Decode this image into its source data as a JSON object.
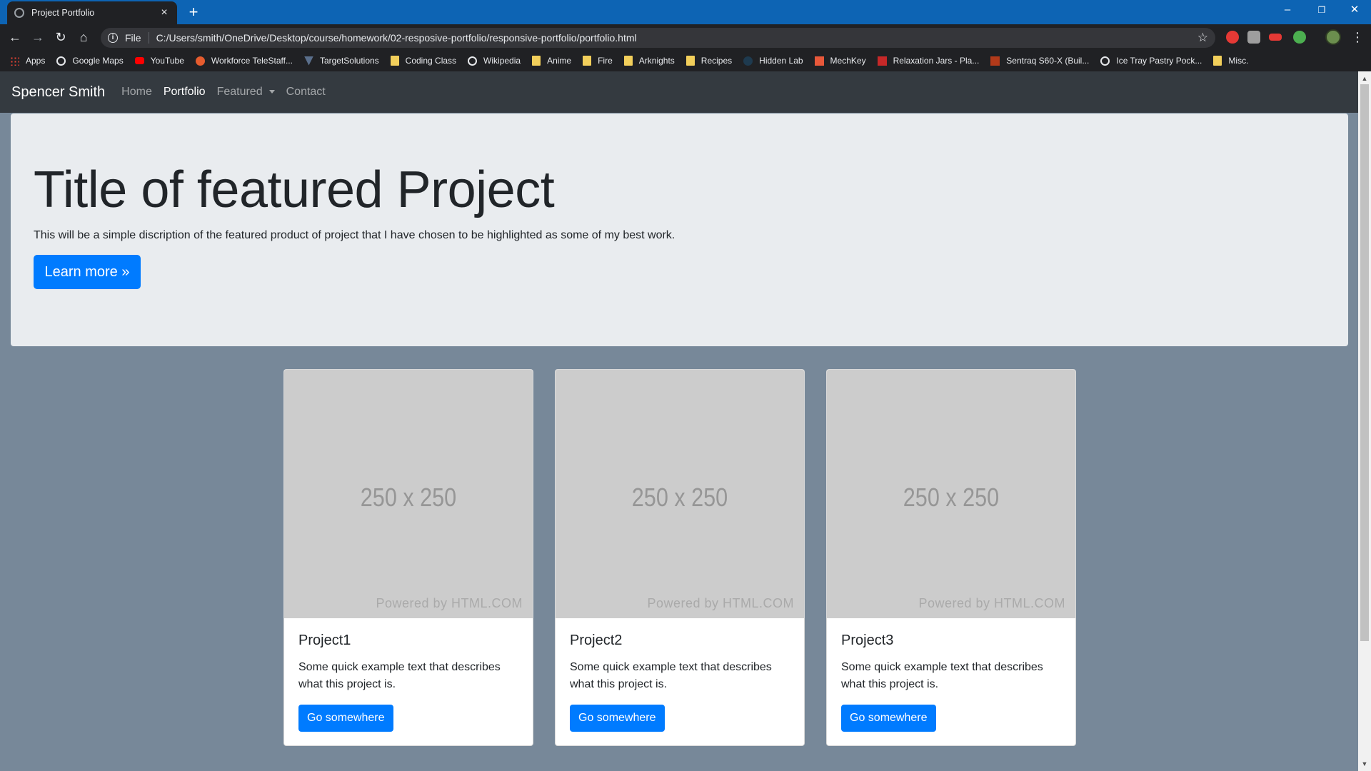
{
  "browser": {
    "tab_title": "Project Portfolio",
    "tab_close": "×",
    "new_tab": "+",
    "window_controls": [
      "–",
      "❐",
      "✕"
    ],
    "address_scheme": "File",
    "address_url": "C:/Users/smith/OneDrive/Desktop/course/homework/02-resposive-portfolio/responsive-portfolio/portfolio.html",
    "bookmarks": [
      {
        "label": "Apps",
        "icon": "apps-grid-icon"
      },
      {
        "label": "Google Maps",
        "icon": "globe-icon"
      },
      {
        "label": "YouTube",
        "icon": "youtube-icon"
      },
      {
        "label": "Workforce TeleStaff...",
        "icon": "telestaff-icon"
      },
      {
        "label": "TargetSolutions",
        "icon": "targetsolutions-icon"
      },
      {
        "label": "Coding Class",
        "icon": "folder-icon"
      },
      {
        "label": "Wikipedia",
        "icon": "globe-icon"
      },
      {
        "label": "Anime",
        "icon": "folder-icon"
      },
      {
        "label": "Fire",
        "icon": "folder-icon"
      },
      {
        "label": "Arknights",
        "icon": "folder-icon"
      },
      {
        "label": "Recipes",
        "icon": "folder-icon"
      },
      {
        "label": "Hidden Lab",
        "icon": "hiddenlab-icon"
      },
      {
        "label": "MechKey",
        "icon": "mechkey-icon"
      },
      {
        "label": "Relaxation Jars - Pla...",
        "icon": "relaxation-icon"
      },
      {
        "label": "Sentraq S60-X (Buil...",
        "icon": "sentraq-icon"
      },
      {
        "label": "Ice Tray Pastry Pock...",
        "icon": "globe-icon"
      },
      {
        "label": "Misc.",
        "icon": "folder-icon"
      }
    ]
  },
  "site": {
    "brand": "Spencer Smith",
    "nav": [
      {
        "label": "Home",
        "active": false
      },
      {
        "label": "Portfolio",
        "active": true
      },
      {
        "label": "Featured",
        "active": false,
        "dropdown": true
      },
      {
        "label": "Contact",
        "active": false
      }
    ],
    "jumbotron": {
      "title": "Title of featured Project",
      "description": "This will be a simple discription of the featured product of project that I have chosen to be highlighted as some of my best work.",
      "button": "Learn more »"
    },
    "cards": [
      {
        "image_text": "250 x 250",
        "image_credit": "Powered by HTML.COM",
        "title": "Project1",
        "text": "Some quick example text that describes what this project is.",
        "button": "Go somewhere"
      },
      {
        "image_text": "250 x 250",
        "image_credit": "Powered by HTML.COM",
        "title": "Project2",
        "text": "Some quick example text that describes what this project is.",
        "button": "Go somewhere"
      },
      {
        "image_text": "250 x 250",
        "image_credit": "Powered by HTML.COM",
        "title": "Project3",
        "text": "Some quick example text that describes what this project is.",
        "button": "Go somewhere"
      }
    ]
  },
  "colors": {
    "tabstrip": "#0d64b4",
    "page_background": "#778899",
    "navbar": "#343a40",
    "jumbotron": "#e9ecef",
    "primary_button": "#007bff"
  }
}
